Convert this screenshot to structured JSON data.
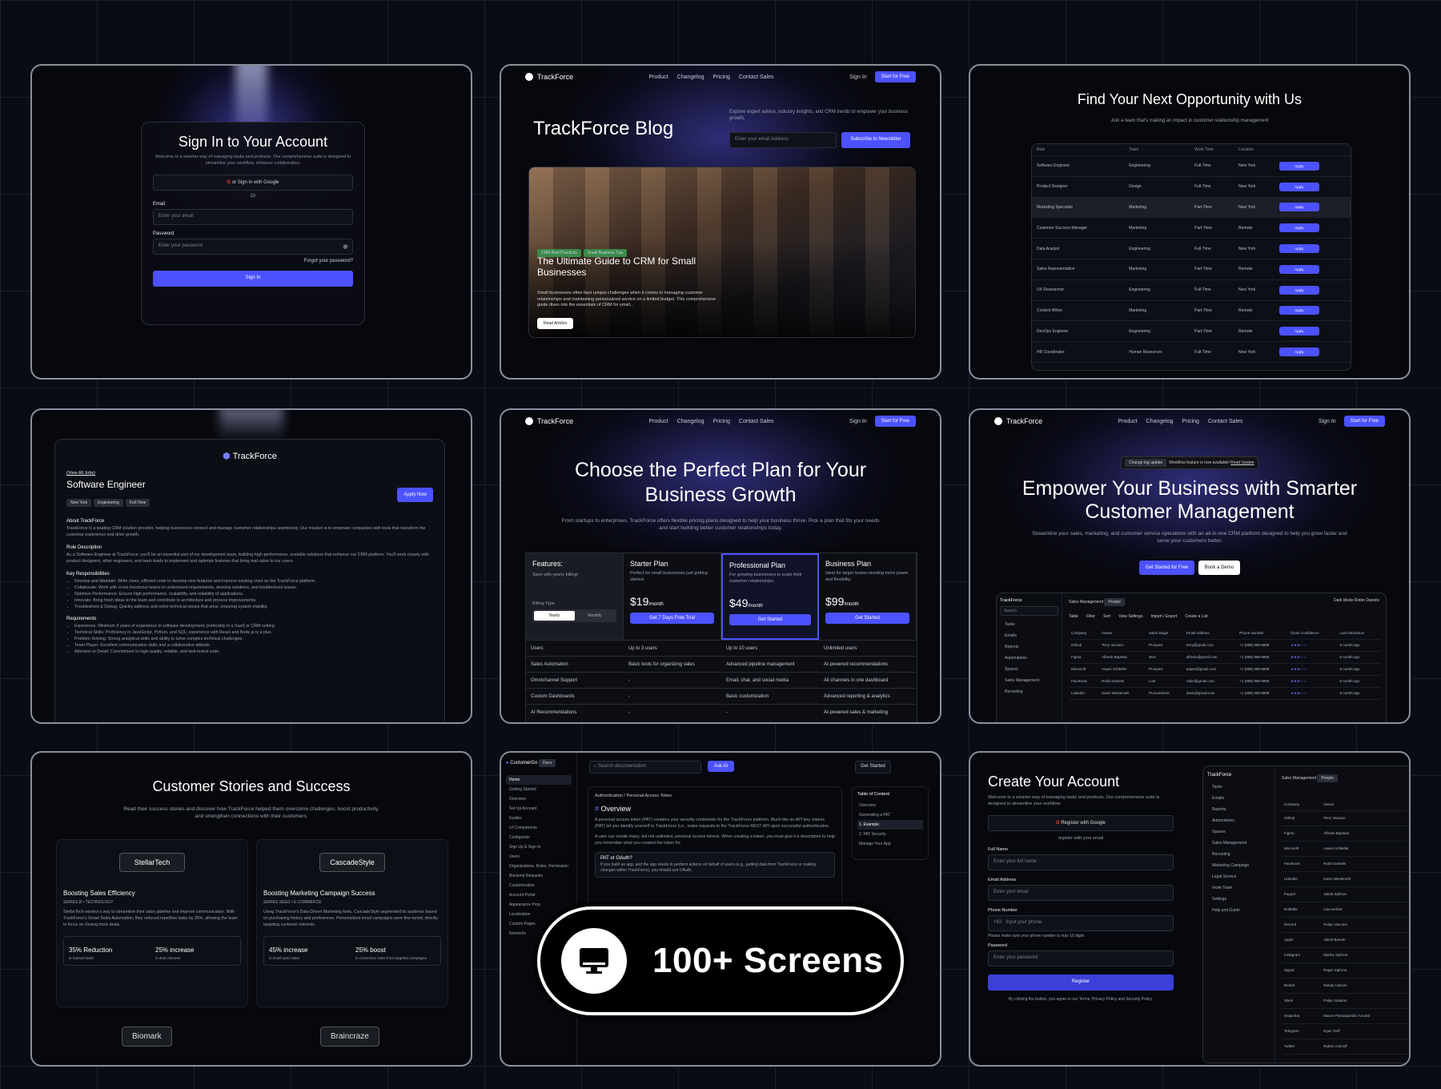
{
  "signin": {
    "title": "Sign In to Your Account",
    "desc": "Welcome to a smarter way of managing tasks and products. Our comprehensive suite is designed to streamline your workflow, enhance collaboration.",
    "google": "or Sign in with Google",
    "or": "Or",
    "email_label": "Email",
    "email_ph": "Enter your email",
    "password_label": "Password",
    "password_ph": "Enter your password",
    "forgot": "Forgot your password?",
    "submit": "Sign In"
  },
  "nav": {
    "brand": "TrackForce",
    "links": [
      "Product",
      "Changelog",
      "Pricing",
      "Contact Sales"
    ],
    "signin": "Sign In",
    "cta": "Start for Free"
  },
  "blog": {
    "title": "TrackForce Blog",
    "desc": "Explore expert advice, industry insights, and CRM trends to empower your business growth.",
    "email_ph": "Enter your email Address",
    "subscribe": "Subscribe to Newsletter",
    "tag1": "CRM Best Practices",
    "tag2": "Small Business Tips",
    "post_title": "The Ultimate Guide to CRM for Small Businesses",
    "post_desc": "Small businesses often face unique challenges when it comes to managing customer relationships and maintaining personalized service on a limited budget. This comprehensive guide dives into the essentials of CRM for small...",
    "read": "Read Articles"
  },
  "careers": {
    "title": "Find Your Next Opportunity with Us",
    "subtitle": "Join a team that's making an impact in customer relationship management",
    "headers": [
      "Role",
      "Team",
      "Work Time",
      "Location",
      ""
    ],
    "apply": "Apply",
    "rows": [
      [
        "Software Engineer",
        "Engineering",
        "Full-Time",
        "New York"
      ],
      [
        "Product Designer",
        "Design",
        "Full-Time",
        "New York"
      ],
      [
        "Marketing Specialist",
        "Marketing",
        "Part-Time",
        "New York"
      ],
      [
        "Customer Success Manager",
        "Marketing",
        "Part-Time",
        "Remote"
      ],
      [
        "Data Analyst",
        "Engineering",
        "Full-Time",
        "New York"
      ],
      [
        "Sales Representative",
        "Marketing",
        "Part-Time",
        "Remote"
      ],
      [
        "UX Researcher",
        "Engineering",
        "Full-Time",
        "New York"
      ],
      [
        "Content Writer",
        "Marketing",
        "Part-Time",
        "Remote"
      ],
      [
        "DevOps Engineer",
        "Engineering",
        "Part-Time",
        "Remote"
      ],
      [
        "HR Coordinator",
        "Human Resources",
        "Full-Time",
        "New York"
      ]
    ]
  },
  "job": {
    "brand": "TrackForce",
    "back": "(View All Jobs)",
    "title": "Software Engineer",
    "tags": [
      "New York",
      "Engineering",
      "Full-Time"
    ],
    "apply": "Apply Now",
    "about_h": "About TrackForce",
    "about": "TrackForce is a leading CRM solution provider, helping businesses connect and manage customer relationships seamlessly. Our mission is to empower companies with tools that transform the customer experience and drive growth.",
    "role_h": "Role Description",
    "role": "As a Software Engineer at TrackForce, you'll be an essential part of our development team, building high-performance, scalable solutions that enhance our CRM platform. You'll work closely with product designers, other engineers, and team leads to implement and optimize features that bring real value to our users.",
    "resp_h": "Key Responsibilities",
    "resp": [
      "Develop and Maintain: Write clean, efficient code to develop new features and improve existing ones on the TrackForce platform.",
      "Collaborate: Work with cross-functional teams to understand requirements, develop solutions, and troubleshoot issues.",
      "Optimize Performance: Ensure high performance, scalability, and reliability of applications.",
      "Innovate: Bring fresh ideas to the team and contribute to architecture and process improvements.",
      "Troubleshoot & Debug: Quickly address and solve technical issues that arise, ensuring system stability."
    ],
    "req_h": "Requirements",
    "req": [
      "Experience: Minimum 3 years of experience in software development, preferably in a SaaS or CRM setting.",
      "Technical Skills: Proficiency in JavaScript, Python, and SQL; experience with React and Node.js is a plus.",
      "Problem-Solving: Strong analytical skills and ability to solve complex technical challenges.",
      "Team Player: Excellent communication skills and a collaborative attitude.",
      "Attention to Detail: Commitment to high-quality, reliable, and well-tested code."
    ]
  },
  "pricing": {
    "title": "Choose the Perfect Plan for Your Business Growth",
    "desc": "From startups to enterprises, TrackForce offers flexible pricing plans designed to help your business thrive. Pick a plan that fits your needs and start building better customer relationships today.",
    "features_h": "Features:",
    "save": "Save with yearly billing!",
    "billing": "Billing Type",
    "yearly": "Yearly",
    "monthly": "Monthly",
    "per": "/month",
    "plans": [
      {
        "name": "Starter Plan",
        "desc": "Perfect for small businesses just getting started.",
        "price": "$19",
        "cta": "Get 7 Days Free Trial"
      },
      {
        "name": "Professional Plan",
        "desc": "For growing businesses to scale their customer relationships.",
        "price": "$49",
        "cta": "Get Started"
      },
      {
        "name": "Business Plan",
        "desc": "Ideal for larger teams needing more power and flexibility.",
        "price": "$99",
        "cta": "Get Started"
      }
    ],
    "rows": [
      [
        "Users",
        "Up to 3 users",
        "Up to 10 users",
        "Unlimited users"
      ],
      [
        "Sales Automation",
        "Basic tools for organizing sales",
        "Advanced pipeline management",
        "AI-powered recommendations"
      ],
      [
        "Omnichannel Support",
        "-",
        "Email, chat, and social media",
        "All channels in one dashboard"
      ],
      [
        "Custom Dashboards",
        "-",
        "Basic customization",
        "Advanced reporting & analytics"
      ],
      [
        "AI Recommendations",
        "-",
        "-",
        "AI-powered sales & marketing"
      ]
    ]
  },
  "hero": {
    "badge": "Change log update",
    "badge_text": "Workflow feature is now available!",
    "badge_link": "Read Update",
    "title": "Empower Your Business with Smarter Customer Management",
    "desc": "Streamline your sales, marketing, and customer service operations with an all-in-one CRM platform designed to help you grow faster and serve your customers better.",
    "cta1": "Get Started for Free",
    "cta2": "Book a Demo",
    "app_brand": "TrackForce",
    "search": "Search",
    "side": [
      "Tasks",
      "Emails",
      "Reports",
      "Automations",
      "Spaces",
      "Sales Management",
      "Recruiting"
    ],
    "crumb": "Sales Management",
    "people": "People",
    "dark": "Dark Mode",
    "user": "Robin Daniels",
    "tool": [
      "Table",
      "Filter",
      "Sort",
      "View Settings",
      "Import / Export",
      "Create a List"
    ],
    "cols": [
      "Company",
      "Owner",
      "Sales Stage",
      "Email Address",
      "Phone Number",
      "Close Confidence",
      "Last Interaction"
    ],
    "rows": [
      [
        "Github",
        "Terry Vaccaro",
        "Prospect",
        "terry@gmail.com",
        "+1 (888) 888-8888",
        "6 month ago"
      ],
      [
        "Figma",
        "Alfredo Baptista",
        "Won",
        "alfredo@gmail.com",
        "+1 (888) 888-8888",
        "6 month ago"
      ],
      [
        "Microsoft",
        "Aspen Schleifer",
        "Prospect",
        "aspen@gmail.com",
        "+1 (888) 888-8888",
        "6 month ago"
      ],
      [
        "Facebook",
        "Robin Daniels",
        "Lost",
        "robin@gmail.com",
        "+1 (888) 888-8888",
        "6 month ago"
      ],
      [
        "LinkedIn",
        "Davis Westervelt",
        "Procurement",
        "davis@gmail.com",
        "+1 (888) 888-8888",
        "6 month ago"
      ]
    ]
  },
  "stories": {
    "title": "Customer Stories and Success",
    "desc": "Read their success stories and discover how TrackForce helped them overcome challenges, boost productivity, and strengthen connections with their customers.",
    "items": [
      {
        "logo": "StellarTech",
        "title": "Boosting Sales Efficiency",
        "meta": "SERIES B  •  TECHNOLOGY",
        "body": "StellarTech wanted a way to streamline their sales pipeline and improve communication. With TrackForce's Smart Sales Automation, they reduced repetitive tasks by 35%, allowing the team to focus on closing more deals.",
        "s1": "35% Reduction",
        "s1d": "in manual tasks",
        "s2": "25% increase",
        "s2d": "in deal closures"
      },
      {
        "logo": "CascadeStyle",
        "title": "Boosting Marketing Campaign Success",
        "meta": "SERIES SEED  •  E-COMMERCE",
        "body": "Using TrackForce's Data-Driven Marketing tools, CascadeStyle segmented its audience based on purchasing history and preferences. Personalized email campaigns were fine-tuned, directly targeting customer interests.",
        "s1": "45% increase",
        "s1d": "in email open rates",
        "s2": "25% boost",
        "s2d": "in conversion rates from targeted campaigns"
      }
    ],
    "logos2": [
      "Biomark",
      "Braincraze"
    ]
  },
  "docs": {
    "brand": "CustomerGo",
    "badge": "Docs",
    "search": "Search documentation",
    "ask": "Ask AI",
    "started": "Get Started",
    "nav": [
      "Home",
      "Getting Started",
      "Overview",
      "Set Up Account",
      "Guides",
      "UI Components",
      "Configurate",
      "Sign Up & Sign In",
      "Users",
      "Organizations, Roles, Permission",
      "Backend Requests",
      "Customization",
      "Account Portal",
      "Appearance Prop",
      "Localization",
      "Custom Pages",
      "Elements"
    ],
    "crumb1": "Authentication /",
    "crumb2": "Personal Access Token",
    "h": "Overview",
    "p1": "A personal access token (PAT) contains your security credentials for the TrackForce platform. Much like an API key, tokens (PAT) let you identify yourself to TrackForce (i.e., make requests to the TrackForce REST API upon successful authentication.",
    "p2": "A user can create many, but not unlimited, personal access tokens. When creating a token, you must give it a description to help you remember what you created the token for.",
    "note_h": "PAT or OAuth?",
    "note": "If you build an app, and the app needs to perform actions on behalf of users (e.g., getting data from TrackForce or making changes within TrackForce), you should use OAuth.",
    "toc_h": "Table of Content",
    "toc": [
      "Overview",
      "Generating a PAT",
      "1. Example",
      "2. PAT Security",
      "Manage Your App"
    ]
  },
  "register": {
    "title": "Create Your Account",
    "desc": "Welcome to a smarter way of managing tasks and products. Our comprehensive suite is designed to streamline your workflow",
    "google": "Register with Google",
    "or": "register with your email",
    "name_l": "Full Name",
    "name_ph": "Enter your full name",
    "email_l": "Email Address",
    "email_ph": "Enter your email",
    "phone_l": "Phone Number",
    "code": "+62",
    "phone_ph": "Input your phone",
    "phone_hint": "Please make sure your phone number is max 10 digits",
    "pw_l": "Password",
    "pw_ph": "Enter your password",
    "submit": "Register",
    "terms": "By clicking the button, you agree to our Terms, Privacy Policy and Security Policy.",
    "app_brand": "TrackForce",
    "app_crumb": "Sales Management",
    "app_people": "People",
    "app_side": [
      "Tasks",
      "Emails",
      "Reports",
      "Automations",
      "Spaces",
      "Sales Management",
      "Recruiting",
      "Marketing Campaign",
      "Legal Service",
      "Invite Team",
      "Settings",
      "Help and Guide"
    ],
    "app_cols": [
      "Company",
      "Owner"
    ],
    "app_rows": [
      [
        "Github",
        "Terry Vaccaro"
      ],
      [
        "Figma",
        "Alfredo Baptista"
      ],
      [
        "Microsoft",
        "Aspen Schleifer"
      ],
      [
        "Facebook",
        "Robin Daniels"
      ],
      [
        "LinkedIn",
        "Davis Westervelt"
      ],
      [
        "Paypal",
        "Jakob Siphron"
      ],
      [
        "Dribbble",
        "Lina Herber"
      ],
      [
        "Discord",
        "Paityn Vaccaro"
      ],
      [
        "Apple",
        "Jakob Botosh"
      ],
      [
        "Instagram",
        "Marley Siphron"
      ],
      [
        "Signal",
        "Roger Siphron"
      ],
      [
        "Reddit",
        "Randy Calzoni"
      ],
      [
        "Slack",
        "Paityn Stanton"
      ],
      [
        "Snapchat",
        "Mason Passaquindici Arcand"
      ],
      [
        "Telegram",
        "Ryan Torff"
      ],
      [
        "Twitter",
        "Ruben Aminoff"
      ]
    ]
  },
  "overlay": {
    "text": "100+ Screens"
  }
}
